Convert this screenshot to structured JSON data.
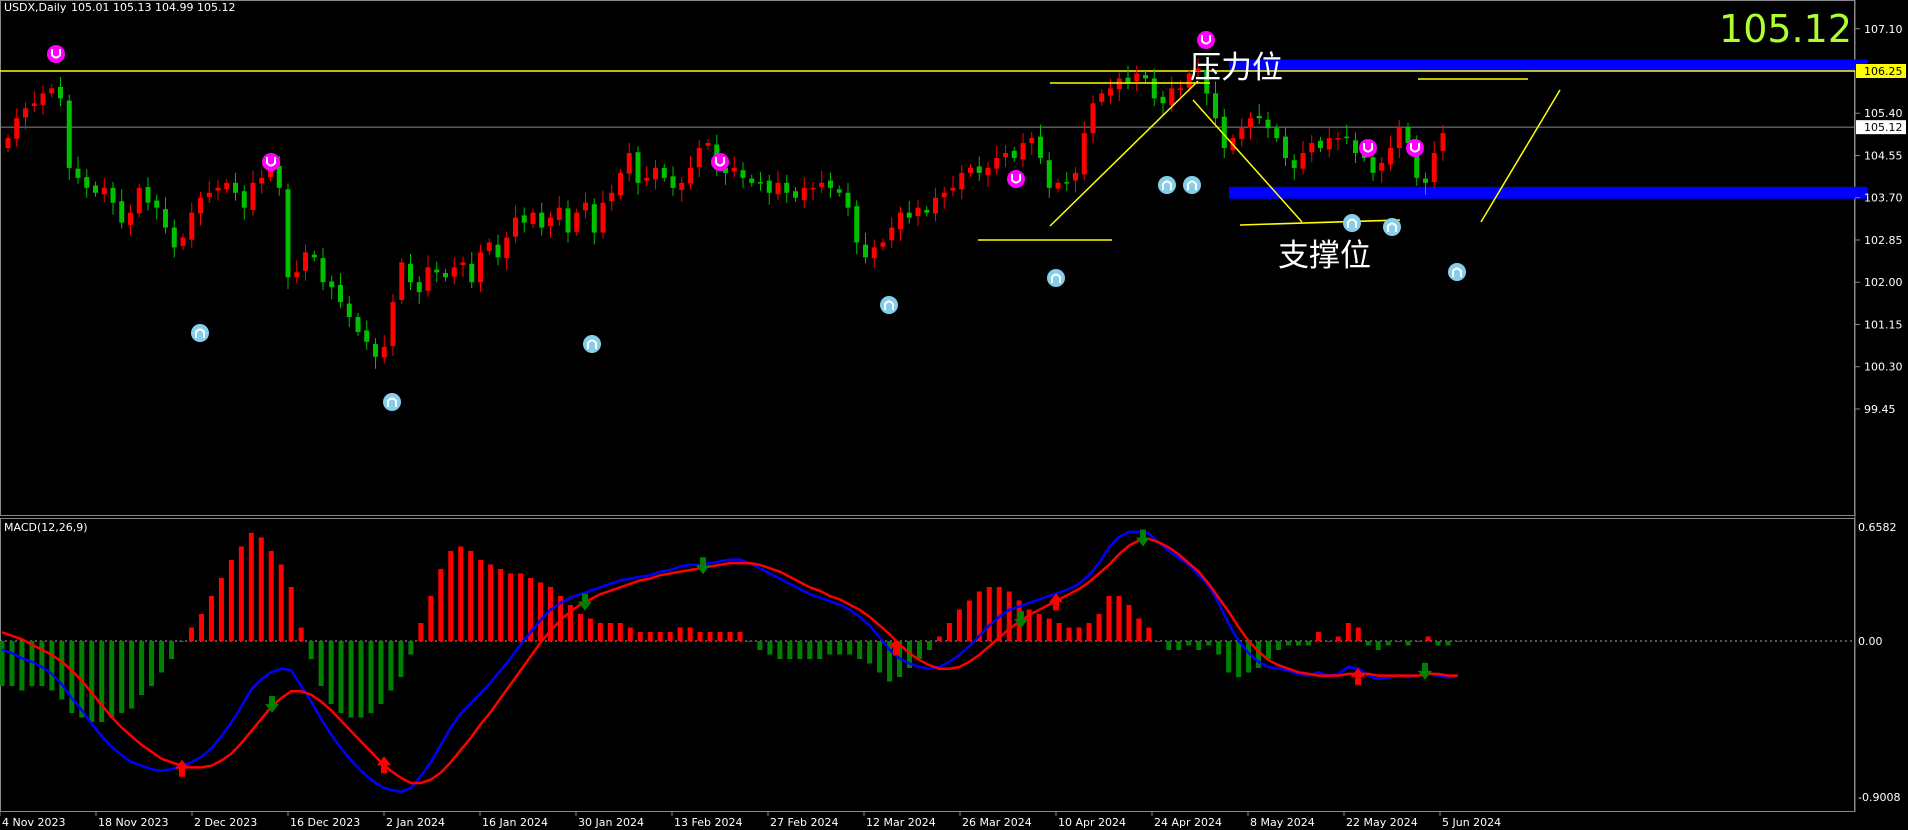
{
  "header": {
    "symbol": "USDX,Daily",
    "ohlc": "105.01 105.13 104.99 105.12",
    "big_price": "105.12"
  },
  "labels": {
    "resistance": "压力位",
    "support": "支撑位",
    "macd_title": "MACD(12,26,9)"
  },
  "colors": {
    "bull": "#ff0000",
    "bear": "#00c000",
    "macd_pos": "#ff0000",
    "macd_neg": "#008000",
    "macd_line": "#0000ff",
    "signal_line": "#ff0000",
    "resistance_line": "#ffff00",
    "zone": "#0000ff",
    "big_price": "#adff2f",
    "fractal_up": "#ff00ff",
    "fractal_down": "#87ceeb"
  },
  "chart_data": [
    {
      "type": "candlestick",
      "symbol": "USDX",
      "timeframe": "Daily",
      "ylim": [
        99.0,
        107.6
      ],
      "y_ticks": [
        "107.10",
        "106.25",
        "105.40",
        "105.12",
        "104.55",
        "103.70",
        "102.85",
        "102.00",
        "101.15",
        "100.30",
        "99.45"
      ],
      "x_ticks": [
        "4 Nov 2023",
        "18 Nov 2023",
        "2 Dec 2023",
        "16 Dec 2023",
        "2 Jan 2024",
        "16 Jan 2024",
        "30 Jan 2024",
        "13 Feb 2024",
        "27 Feb 2024",
        "12 Mar 2024",
        "26 Mar 2024",
        "10 Apr 2024",
        "24 Apr 2024",
        "8 May 2024",
        "22 May 2024",
        "5 Jun 2024"
      ],
      "resistance_level": 106.25,
      "current_price": 105.12,
      "zones": [
        {
          "name": "resistance",
          "from_bar": 140,
          "to_bar": 213,
          "top": 106.48,
          "bottom": 106.25
        },
        {
          "name": "support",
          "from_bar": 140,
          "to_bar": 213,
          "top": 103.92,
          "bottom": 103.68
        }
      ],
      "closes": [
        104.9,
        105.3,
        105.5,
        105.6,
        105.8,
        105.9,
        105.7,
        104.3,
        104.1,
        103.9,
        103.8,
        103.9,
        103.6,
        103.2,
        103.4,
        103.9,
        103.6,
        103.5,
        103.1,
        102.7,
        102.9,
        103.4,
        103.7,
        103.8,
        103.9,
        104.0,
        103.8,
        103.5,
        104.0,
        104.1,
        104.3,
        103.9,
        102.1,
        102.2,
        102.6,
        102.5,
        102.0,
        101.9,
        101.6,
        101.3,
        101.0,
        100.8,
        100.5,
        100.7,
        101.6,
        102.4,
        102.0,
        101.8,
        102.3,
        102.2,
        102.1,
        102.3,
        102.4,
        102.0,
        102.6,
        102.8,
        102.5,
        102.9,
        103.3,
        103.2,
        103.4,
        103.1,
        103.3,
        103.5,
        103.0,
        103.4,
        103.6,
        103.0,
        103.6,
        103.8,
        104.2,
        104.6,
        104.0,
        104.1,
        104.3,
        104.1,
        103.9,
        104.0,
        104.3,
        104.7,
        104.8,
        104.3,
        104.2,
        104.3,
        104.1,
        104.0,
        104.0,
        103.8,
        104.0,
        103.8,
        103.7,
        103.9,
        103.9,
        104.0,
        103.9,
        103.8,
        103.5,
        102.8,
        102.5,
        102.7,
        102.8,
        103.1,
        103.4,
        103.3,
        103.5,
        103.4,
        103.7,
        103.8,
        103.9,
        104.2,
        104.3,
        104.2,
        104.3,
        104.5,
        104.6,
        104.5,
        104.8,
        104.9,
        104.5,
        103.9,
        104.0,
        104.0,
        104.2,
        105.0,
        105.6,
        105.8,
        105.9,
        106.1,
        106.0,
        106.2,
        106.1,
        105.7,
        105.6,
        105.9,
        105.9,
        106.2,
        106.3,
        105.8,
        105.3,
        104.7,
        104.9,
        105.1,
        105.3,
        105.3,
        105.1,
        104.9,
        104.5,
        104.3,
        104.6,
        104.8,
        104.7,
        104.9,
        104.9,
        104.9,
        104.6,
        104.5,
        104.2,
        104.4,
        104.7,
        105.1,
        104.8,
        104.1,
        104.0,
        104.6,
        105.0
      ],
      "macd": [
        -0.05,
        -0.07,
        -0.1,
        -0.12,
        -0.15,
        -0.19,
        -0.25,
        -0.33,
        -0.4,
        -0.48,
        -0.55,
        -0.61,
        -0.66,
        -0.7,
        -0.72,
        -0.74,
        -0.75,
        -0.74,
        -0.72,
        -0.7,
        -0.67,
        -0.62,
        -0.55,
        -0.47,
        -0.38,
        -0.28,
        -0.22,
        -0.18,
        -0.16,
        -0.17,
        -0.26,
        -0.35,
        -0.45,
        -0.54,
        -0.62,
        -0.69,
        -0.75,
        -0.8,
        -0.84,
        -0.86,
        -0.87,
        -0.85,
        -0.78,
        -0.7,
        -0.6,
        -0.5,
        -0.42,
        -0.36,
        -0.3,
        -0.24,
        -0.17,
        -0.1,
        -0.02,
        0.05,
        0.12,
        0.18,
        0.22,
        0.25,
        0.27,
        0.29,
        0.31,
        0.33,
        0.35,
        0.36,
        0.37,
        0.38,
        0.4,
        0.41,
        0.43,
        0.44,
        0.44,
        0.45,
        0.46,
        0.47,
        0.47,
        0.45,
        0.42,
        0.39,
        0.36,
        0.33,
        0.3,
        0.27,
        0.25,
        0.23,
        0.21,
        0.18,
        0.14,
        0.09,
        0.02,
        -0.05,
        -0.1,
        -0.13,
        -0.15,
        -0.16,
        -0.15,
        -0.12,
        -0.08,
        -0.03,
        0.03,
        0.09,
        0.14,
        0.18,
        0.2,
        0.22,
        0.24,
        0.26,
        0.28,
        0.3,
        0.33,
        0.38,
        0.45,
        0.54,
        0.6,
        0.63,
        0.63,
        0.62,
        0.57,
        0.52,
        0.48,
        0.44,
        0.38,
        0.32,
        0.22,
        0.1,
        0.0,
        -0.07,
        -0.12,
        -0.15,
        -0.16,
        -0.17,
        -0.19,
        -0.2,
        -0.18,
        -0.2,
        -0.19,
        -0.15,
        -0.16,
        -0.2,
        -0.22,
        -0.21,
        -0.2,
        -0.21,
        -0.2,
        -0.18,
        -0.2,
        -0.21,
        -0.2
      ],
      "signal": [
        0.05,
        0.03,
        0.01,
        -0.02,
        -0.05,
        -0.08,
        -0.12,
        -0.17,
        -0.23,
        -0.3,
        -0.37,
        -0.44,
        -0.5,
        -0.55,
        -0.6,
        -0.64,
        -0.68,
        -0.7,
        -0.72,
        -0.73,
        -0.73,
        -0.72,
        -0.69,
        -0.65,
        -0.59,
        -0.52,
        -0.45,
        -0.38,
        -0.33,
        -0.29,
        -0.29,
        -0.31,
        -0.35,
        -0.4,
        -0.46,
        -0.52,
        -0.58,
        -0.64,
        -0.7,
        -0.75,
        -0.79,
        -0.82,
        -0.82,
        -0.8,
        -0.76,
        -0.7,
        -0.63,
        -0.56,
        -0.48,
        -0.41,
        -0.33,
        -0.25,
        -0.17,
        -0.09,
        -0.01,
        0.06,
        0.12,
        0.17,
        0.21,
        0.24,
        0.27,
        0.29,
        0.31,
        0.33,
        0.35,
        0.36,
        0.38,
        0.39,
        0.4,
        0.41,
        0.42,
        0.43,
        0.44,
        0.45,
        0.45,
        0.45,
        0.44,
        0.42,
        0.4,
        0.37,
        0.34,
        0.31,
        0.29,
        0.26,
        0.24,
        0.21,
        0.18,
        0.14,
        0.09,
        0.04,
        -0.02,
        -0.07,
        -0.11,
        -0.14,
        -0.16,
        -0.16,
        -0.15,
        -0.12,
        -0.08,
        -0.03,
        0.02,
        0.07,
        0.11,
        0.15,
        0.18,
        0.21,
        0.24,
        0.27,
        0.3,
        0.34,
        0.39,
        0.44,
        0.5,
        0.55,
        0.58,
        0.59,
        0.57,
        0.54,
        0.5,
        0.45,
        0.4,
        0.33,
        0.25,
        0.17,
        0.08,
        0.0,
        -0.06,
        -0.11,
        -0.14,
        -0.16,
        -0.18,
        -0.19,
        -0.2,
        -0.2,
        -0.2,
        -0.19,
        -0.19,
        -0.19,
        -0.2,
        -0.2,
        -0.2,
        -0.2,
        -0.2,
        -0.19,
        -0.19,
        -0.2,
        -0.2
      ]
    },
    {
      "type": "macd",
      "title": "MACD(12,26,9)",
      "y_ticks": [
        "0.6582",
        "0.00",
        "-0.9008"
      ],
      "ylim": [
        -0.9008,
        0.6582
      ]
    }
  ]
}
